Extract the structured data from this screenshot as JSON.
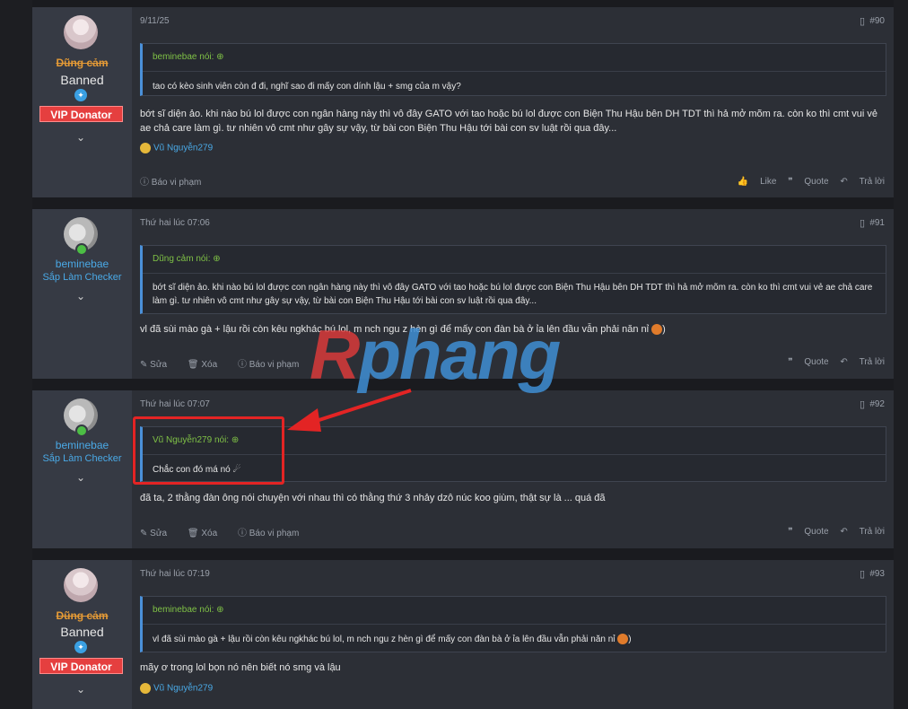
{
  "posts": [
    {
      "date": "9/11/25",
      "number": "#90",
      "user": {
        "name": "Dũng cảm",
        "title": "Banned",
        "badge": "VIP Donator"
      },
      "quote": {
        "author": "beminebae nói:",
        "text": "tao có kèo sinh viên còn đ đi, nghĩ sao đi mấy con dính lậu + smg của m vậy?"
      },
      "body": "bớt sĩ diện ảo. khi nào bú lol được con ngân hàng này thì vô đây GATO với tao hoặc bú lol được con Biện Thu Hậu bên DH TDT thì hả mở mõm ra. còn ko thì cmt vui vẻ ae chả care làm gì. tư nhiên vô cmt như gây sự vậy, từ bài con Biện Thu Hậu tới bài con sv luật rồi qua đây...",
      "reaction": "Vũ Nguyễn279",
      "report": "Báo vi phạm",
      "like": "Like",
      "quote_btn": "Quote",
      "reply": "Trả lời"
    },
    {
      "date": "Thứ hai lúc 07:06",
      "number": "#91",
      "user": {
        "name": "beminebae",
        "title": "Sắp Làm Checker"
      },
      "quote": {
        "author": "Dũng cảm nói:",
        "text": "bớt sĩ diện ảo. khi nào bú lol được con ngân hàng này thì vô đây GATO với tao hoặc bú lol được con Biện Thu Hậu bên DH TDT thì hả mở mõm ra. còn ko thì cmt vui vẻ ae chả care làm gì. tư nhiên vô cmt như gây sự vậy, từ bài con Biện Thu Hậu tới bài con sv luật rồi qua đây..."
      },
      "body": "vl đã sùi mào gà + lậu rồi còn kêu ngkhác bú lol, m nch ngu z hèn gì để mấy con đàn bà ở ỉa lên đầu vẫn phải năn nỉ",
      "edit": "Sửa",
      "delete": "Xóa",
      "report": "Báo vi phạm",
      "quote_btn": "Quote",
      "reply": "Trả lời"
    },
    {
      "date": "Thứ hai lúc 07:07",
      "number": "#92",
      "user": {
        "name": "beminebae",
        "title": "Sắp Làm Checker"
      },
      "quote": {
        "author": "Vũ Nguyễn279 nói:",
        "text": "Chắc con đó má nó"
      },
      "body": "đã ta, 2 thằng đàn ông nói chuyện với nhau thì có thằng thứ 3 nhảy dzô núc koo giùm, thật sự là ... quá đã",
      "edit": "Sửa",
      "delete": "Xóa",
      "report": "Báo vi phạm",
      "quote_btn": "Quote",
      "reply": "Trả lời"
    },
    {
      "date": "Thứ hai lúc 07:19",
      "number": "#93",
      "user": {
        "name": "Dũng cảm",
        "title": "Banned",
        "badge": "VIP Donator"
      },
      "quote": {
        "author": "beminebae nói:",
        "text": "vl đã sùi mào gà + lậu rồi còn kêu ngkhác bú lol, m nch ngu z hèn gì để mấy con đàn bà ở ỉa lên đầu vẫn phải năn nỉ"
      },
      "body": "mãy ơ trong lol bọn nó nên biết nó smg và lậu",
      "reaction": "Vũ Nguyễn279"
    }
  ],
  "watermark": {
    "part1": "R",
    "part2": "phang"
  },
  "icons": {
    "bookmark": "bookmark-icon",
    "chevron": "chevron-down-icon",
    "arrow_up": "arrow-up-circle-icon"
  }
}
